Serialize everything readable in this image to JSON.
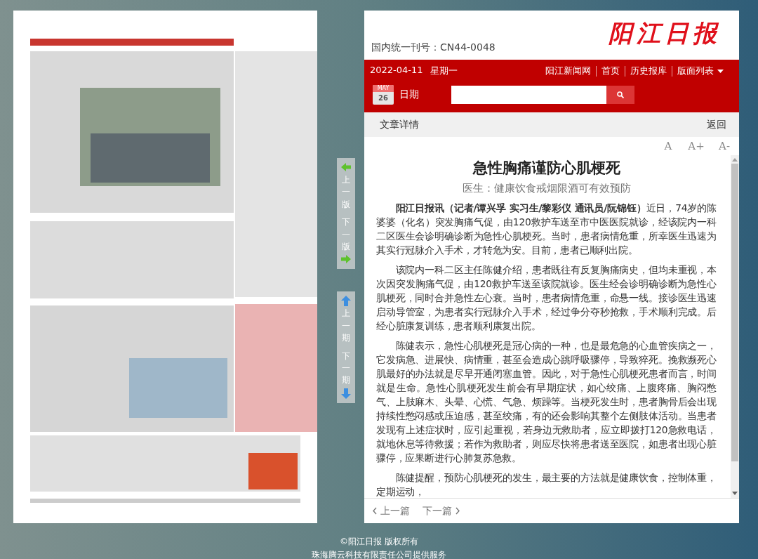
{
  "newspaper_page": {
    "kind": "picture"
  },
  "page_nav": [
    {
      "label": "上一版",
      "kind": "left"
    },
    {
      "label": "下一版",
      "kind": "right"
    },
    {
      "label": "上一期",
      "kind": "up"
    },
    {
      "label": "下一期",
      "kind": "down"
    }
  ],
  "header": {
    "issn": "国内统一刊号：CN44-0048",
    "logo": "阳江日报"
  },
  "top_bar": {
    "date": "2022-04-11",
    "weekday": "星期一",
    "links": [
      {
        "label": "阳江新闻网",
        "kind": "link"
      },
      {
        "label": "首页",
        "kind": "link"
      },
      {
        "label": "历史报库",
        "kind": "link"
      },
      {
        "label": "版面列表",
        "kind": "dropdown"
      }
    ]
  },
  "date_picker": {
    "month": "MAY",
    "day": "26",
    "label": "日期"
  },
  "article_panel": {
    "title": "文章详情",
    "back": "返回",
    "font_buttons": [
      "A",
      "A+",
      "A-"
    ],
    "headline": "急性胸痛谨防心肌梗死",
    "subtitle": "医生：健康饮食戒烟限酒可有效预防",
    "paragraphs": [
      "**阳江日报讯（记者/谭兴孚 实习生/黎彩仪 通讯员/阮锦钰）**近日，74岁的陈婆婆（化名）突发胸痛气促，由120救护车送至市中医医院就诊，经该院内一科二区医生会诊明确诊断为急性心肌梗死。当时，患者病情危重，所幸医生迅速为其实行冠脉介入手术，才转危为安。目前，患者已顺利出院。",
      "该院内一科二区主任陈健介绍，患者既往有反复胸痛病史，但均未重视，本次因突发胸痛气促，由120救护车送至该院就诊。医生经会诊明确诊断为急性心肌梗死，同时合并急性左心衰。当时，患者病情危重，命悬一线。接诊医生迅速启动导管室，为患者实行冠脉介入手术，经过争分夺秒抢救，手术顺利完成。后经心脏康复训练，患者顺利康复出院。",
      "陈健表示，急性心肌梗死是冠心病的一种，也是最危急的心血管疾病之一，它发病急、进展快、病情重，甚至会造成心跳呼吸骤停，导致猝死。挽救濒死心肌最好的办法就是尽早开通闭塞血管。因此，对于急性心肌梗死患者而言，时间就是生命。急性心肌梗死发生前会有早期症状，如心绞痛、上腹疼痛、胸闷憋气、上肢麻木、头晕、心慌、气急、烦躁等。当梗死发生时，患者胸骨后会出现持续性憋闷感或压迫感，甚至绞痛，有的还会影响其整个左侧肢体活动。当患者发现有上述症状时，应引起重视，若身边无救助者，应立即拨打120急救电话，就地休息等待救援；若作为救助者，则应尽快将患者送至医院，如患者出现心脏骤停，应果断进行心肺复苏急救。",
      "陈健提醒，预防心肌梗死的发生，最主要的方法就是健康饮食，控制体重，定期运动，"
    ],
    "pager": [
      {
        "label": "上一篇",
        "kind": "prev"
      },
      {
        "label": "下一篇",
        "kind": "next"
      }
    ]
  },
  "footer": [
    "©阳江日报 版权所有",
    "珠海腾云科技有限责任公司提供服务"
  ]
}
